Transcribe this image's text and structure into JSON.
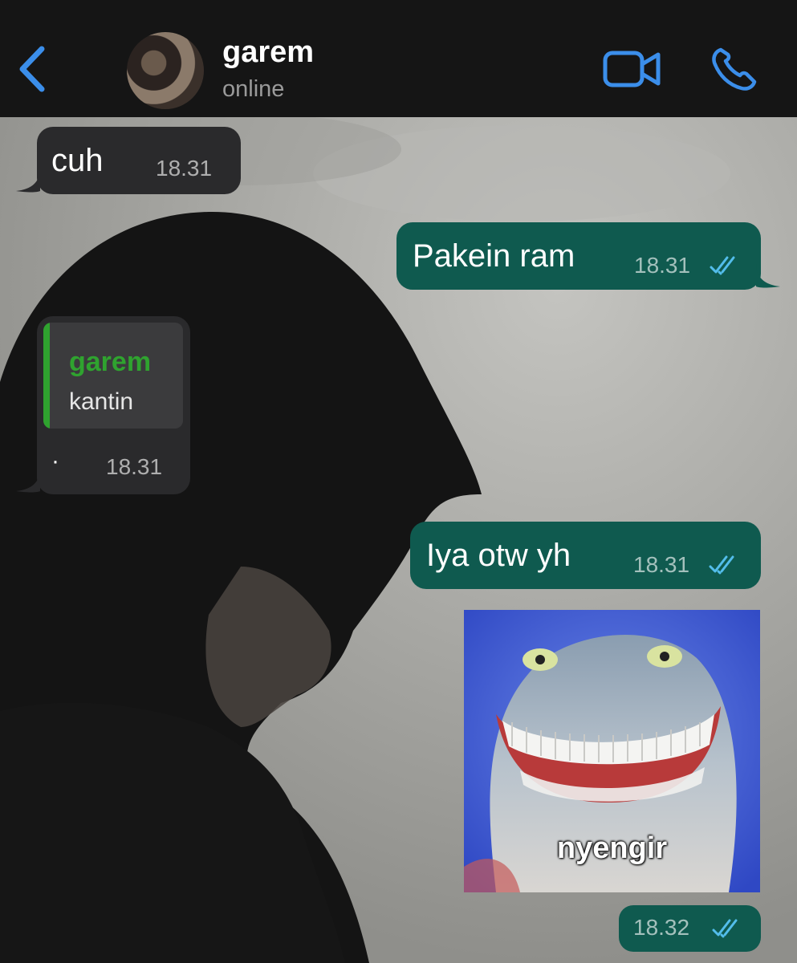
{
  "header": {
    "contact_name": "garem",
    "contact_status": "online",
    "icons": {
      "back": "chevron-left-icon",
      "video": "video-camera-icon",
      "call": "phone-icon"
    },
    "accent_color": "#3b8eea"
  },
  "messages": [
    {
      "direction": "incoming",
      "text": "cuh",
      "time": "18.31"
    },
    {
      "direction": "outgoing",
      "text": "Pakein ram",
      "time": "18.31",
      "status": "read"
    },
    {
      "direction": "incoming",
      "reply_to": {
        "name": "garem",
        "text": "kantin"
      },
      "text": "·",
      "time": "18.31"
    },
    {
      "direction": "outgoing",
      "text": "Iya otw yh",
      "time": "18.31",
      "status": "read"
    },
    {
      "direction": "outgoing",
      "type": "sticker",
      "caption": "nyengir",
      "time": "18.32",
      "status": "read"
    }
  ],
  "colors": {
    "incoming_bubble": "#2a2a2c",
    "outgoing_bubble": "#0f5a4f",
    "read_ticks": "#53bdeb",
    "reply_name": "#2fa32f"
  }
}
